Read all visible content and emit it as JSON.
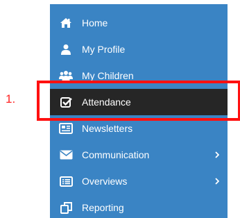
{
  "sidebar": {
    "items": [
      {
        "label": "Home",
        "icon": "home-icon",
        "active": false,
        "has_submenu": false
      },
      {
        "label": "My Profile",
        "icon": "user-icon",
        "active": false,
        "has_submenu": false
      },
      {
        "label": "My Children",
        "icon": "users-icon",
        "active": false,
        "has_submenu": false
      },
      {
        "label": "Attendance",
        "icon": "check-square-icon",
        "active": true,
        "has_submenu": false
      },
      {
        "label": "Newsletters",
        "icon": "newspaper-icon",
        "active": false,
        "has_submenu": false
      },
      {
        "label": "Communication",
        "icon": "envelope-icon",
        "active": false,
        "has_submenu": true
      },
      {
        "label": "Overviews",
        "icon": "list-alt-icon",
        "active": false,
        "has_submenu": true
      },
      {
        "label": "Reporting",
        "icon": "copy-icon",
        "active": false,
        "has_submenu": false
      }
    ]
  },
  "annotation": {
    "step_label": "1.",
    "color": "#ff1010"
  },
  "colors": {
    "sidebar_bg": "#3a84c4",
    "active_bg": "#262626",
    "text": "#ffffff"
  }
}
